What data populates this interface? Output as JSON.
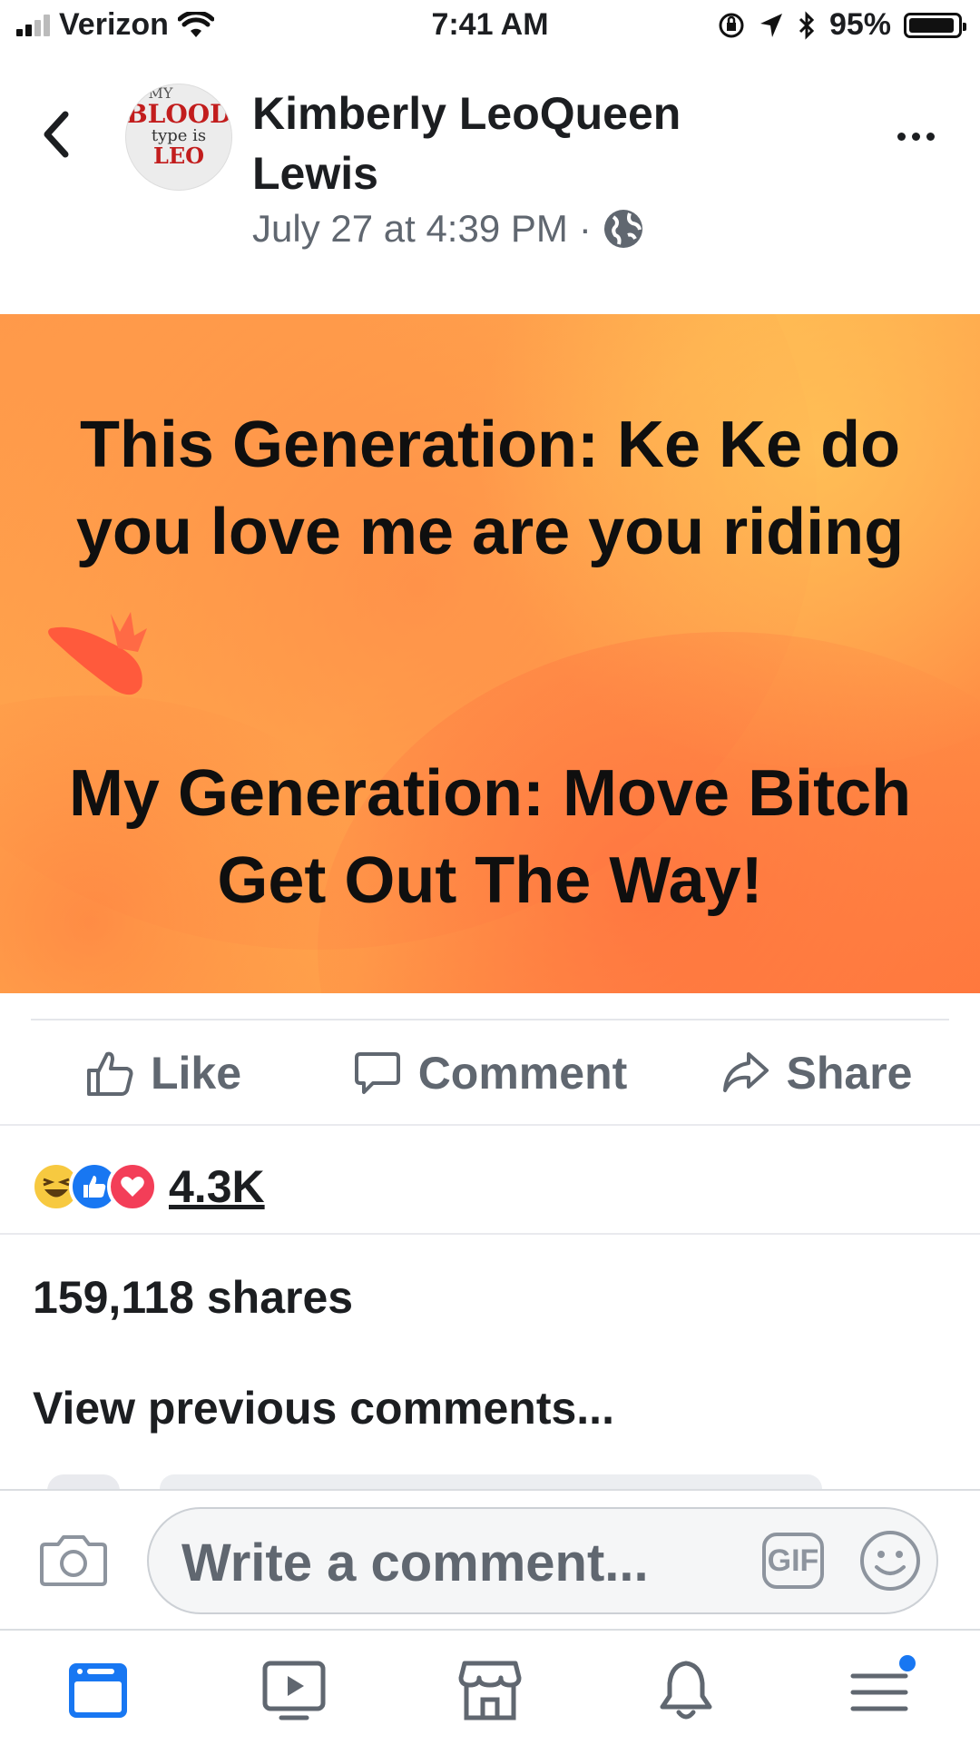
{
  "status_bar": {
    "carrier": "Verizon",
    "time": "7:41 AM",
    "battery_percent": "95%",
    "battery_level": 0.95
  },
  "header": {
    "avatar_text": {
      "line1": "MY",
      "line2": "BLOOD",
      "line3": "type is",
      "line4": "LEO"
    },
    "author": "Kimberly LeoQueen Lewis",
    "timestamp": "July 27 at 4:39 PM",
    "separator": "·"
  },
  "post": {
    "background_colors": [
      "#ff9a4a",
      "#ffb24f",
      "#ff7a3e"
    ],
    "text_line_1": "This Generation: Ke Ke do you love me are you riding",
    "text_line_2": "My Generation: Move Bitch Get Out The Way!"
  },
  "actions": {
    "like": "Like",
    "comment": "Comment",
    "share": "Share"
  },
  "reactions": {
    "icons": [
      "haha-icon",
      "like-icon",
      "love-icon"
    ],
    "count": "4.3K"
  },
  "shares": "159,118 shares",
  "view_previous": "View previous comments...",
  "composer": {
    "placeholder": "Write a comment...",
    "gif_label": "GIF"
  },
  "nav": {
    "items": [
      "news-feed-icon",
      "watch-icon",
      "marketplace-icon",
      "notifications-icon",
      "menu-icon"
    ],
    "accent": "#1877f2"
  }
}
